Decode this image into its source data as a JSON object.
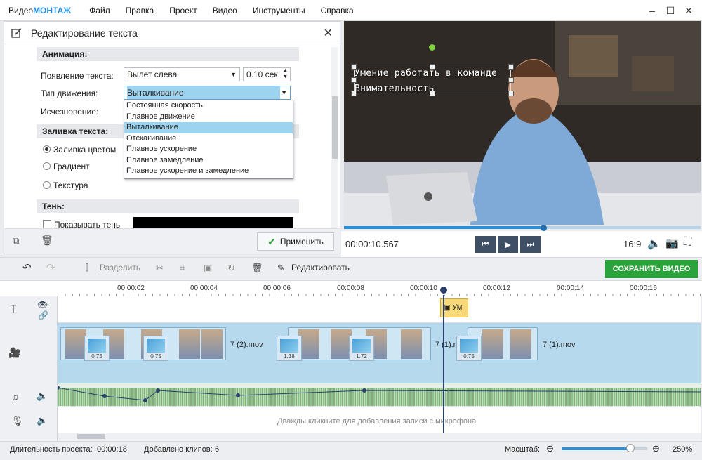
{
  "app": {
    "logo_prefix": "Видео",
    "logo_bold": "МОНТАЖ",
    "menu": [
      "Файл",
      "Правка",
      "Проект",
      "Видео",
      "Инструменты",
      "Справка"
    ]
  },
  "window_controls": {
    "minimize": "–",
    "maximize": "☐",
    "close": "✕"
  },
  "panel": {
    "title": "Редактирование текста",
    "animation_section": "Анимация:",
    "appear_label": "Появление текста:",
    "appear_value": "Вылет слева",
    "appear_duration": "0.10 сек.",
    "motion_label": "Тип движения:",
    "motion_value": "Выталкивание",
    "disappear_label": "Исчезновение:",
    "motion_options": [
      "Постоянная скорость",
      "Плавное движение",
      "Выталкивание",
      "Отскакивание",
      "Плавное ускорение",
      "Плавное замедление",
      "Плавное ускорение и замедление"
    ],
    "selected_option": "Выталкивание",
    "fill_section": "Заливка текста:",
    "fill_color": "Заливка цветом",
    "fill_gradient": "Градиент",
    "fill_texture": "Текстура",
    "shadow_section": "Тень:",
    "shadow_checkbox": "Показывать тень",
    "apply_button": "Применить"
  },
  "preview": {
    "overlay_line1": "Умение работать в команде",
    "overlay_line2": "Внимательность",
    "timecode": "00:00:10.567",
    "progress": 0.56,
    "aspect": "16:9"
  },
  "toolbar": {
    "split": "Разделить",
    "edit": "Редактировать",
    "save": "СОХРАНИТЬ ВИДЕО"
  },
  "ruler": [
    "00:00:02",
    "00:00:04",
    "00:00:06",
    "00:00:08",
    "00:00:10",
    "00:00:12",
    "00:00:14",
    "00:00:16"
  ],
  "timeline": {
    "text_clip": "Ум",
    "clip1_name": "7 (2).mov",
    "clip2_name": "7 (1).r",
    "clip3_name": "7 (1).mov",
    "transitions": [
      "0.75",
      "0.75",
      "1.18",
      "1.72",
      "0.75"
    ],
    "mic_hint": "Дважды кликните для добавления записи с микрофона"
  },
  "status": {
    "duration_label": "Длительность проекта:",
    "duration_value": "00:00:18",
    "clips_label": "Добавлено клипов:",
    "clips_value": "6",
    "zoom_label": "Масштаб:",
    "zoom_value": "250%",
    "zoom_level": 0.8
  },
  "colors": {
    "accent": "#2b8fd8",
    "save": "#2aa33a",
    "selected": "#9cd3ee"
  }
}
